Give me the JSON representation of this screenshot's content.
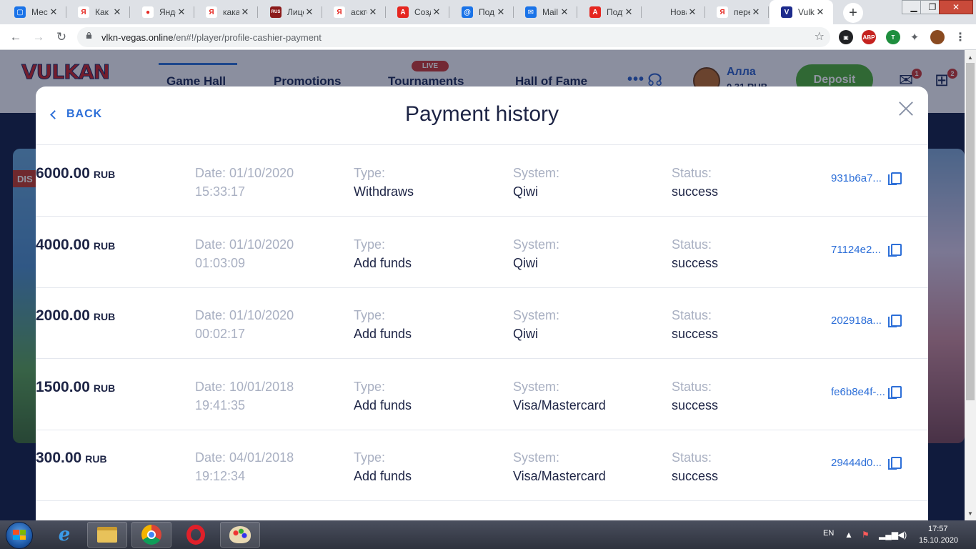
{
  "browser": {
    "tabs": [
      {
        "title": "Месс",
        "favicon_color": "#1a73e8",
        "favicon_glyph": "▢"
      },
      {
        "title": "Как в",
        "favicon_color": "#ffffff",
        "favicon_glyph": "Я",
        "favicon_text_color": "#e52620"
      },
      {
        "title": "Янде",
        "favicon_color": "#ffffff",
        "favicon_glyph": "●",
        "favicon_text_color": "#e52620"
      },
      {
        "title": "какая",
        "favicon_color": "#ffffff",
        "favicon_glyph": "Я",
        "favicon_text_color": "#e52620"
      },
      {
        "title": "Лице",
        "favicon_color": "#8b1a1a",
        "favicon_glyph": "RUS"
      },
      {
        "title": "аскге",
        "favicon_color": "#ffffff",
        "favicon_glyph": "Я",
        "favicon_text_color": "#e52620"
      },
      {
        "title": "Созд",
        "favicon_color": "#e52620",
        "favicon_glyph": "A"
      },
      {
        "title": "Под",
        "favicon_color": "#1a73e8",
        "favicon_glyph": "@"
      },
      {
        "title": "Mail.",
        "favicon_color": "#1a73e8",
        "favicon_glyph": "✉"
      },
      {
        "title": "Подт",
        "favicon_color": "#e52620",
        "favicon_glyph": "A"
      },
      {
        "title": "Новая вк",
        "favicon_color": "",
        "favicon_glyph": ""
      },
      {
        "title": "пере",
        "favicon_color": "#ffffff",
        "favicon_glyph": "Я",
        "favicon_text_color": "#e52620"
      },
      {
        "title": "Vulk",
        "favicon_color": "#1d2b8c",
        "favicon_glyph": "V",
        "active": true
      }
    ],
    "url_host": "vlkn-vegas.online",
    "url_path": "/en#!/player/profile-cashier-payment",
    "extensions": [
      {
        "name": "reader-icon",
        "color": "#202124",
        "badge": ""
      },
      {
        "name": "adblock-icon",
        "color": "#c5221f",
        "badge": "1",
        "label": "ABP"
      },
      {
        "name": "translate-icon",
        "color": "#1e8e3e",
        "badge": "DE",
        "label": "T"
      },
      {
        "name": "extensions-icon",
        "color": "#5f6368",
        "badge": ""
      }
    ]
  },
  "site": {
    "nav": [
      "Game Hall",
      "Promotions",
      "Tournaments",
      "Hall of Fame"
    ],
    "live_badge": "LIVE",
    "username": "Алла",
    "balance": "0.31 RUB",
    "deposit_label": "Deposit",
    "mail_count": "1",
    "gift_count": "2",
    "banner_tag": "DIS"
  },
  "modal": {
    "back_label": "BACK",
    "title": "Payment history",
    "type_label": "Type:",
    "system_label": "System:",
    "status_label": "Status:",
    "rows": [
      {
        "amount": "6000.00",
        "currency": "RUB",
        "date": "Date: 01/10/2020",
        "time": "15:33:17",
        "type": "Withdraws",
        "system": "Qiwi",
        "status": "success",
        "txid": "931b6a7..."
      },
      {
        "amount": "4000.00",
        "currency": "RUB",
        "date": "Date: 01/10/2020",
        "time": "01:03:09",
        "type": "Add funds",
        "system": "Qiwi",
        "status": "success",
        "txid": "71124e2..."
      },
      {
        "amount": "2000.00",
        "currency": "RUB",
        "date": "Date: 01/10/2020",
        "time": "00:02:17",
        "type": "Add funds",
        "system": "Qiwi",
        "status": "success",
        "txid": "202918a..."
      },
      {
        "amount": "1500.00",
        "currency": "RUB",
        "date": "Date: 10/01/2018",
        "time": "19:41:35",
        "type": "Add funds",
        "system": "Visa/Mastercard",
        "status": "success",
        "txid": "fe6b8e4f-..."
      },
      {
        "amount": "300.00",
        "currency": "RUB",
        "date": "Date: 04/01/2018",
        "time": "19:12:34",
        "type": "Add funds",
        "system": "Visa/Mastercard",
        "status": "success",
        "txid": "29444d0..."
      }
    ]
  },
  "taskbar": {
    "language": "EN",
    "time": "17:57",
    "date": "15.10.2020"
  }
}
